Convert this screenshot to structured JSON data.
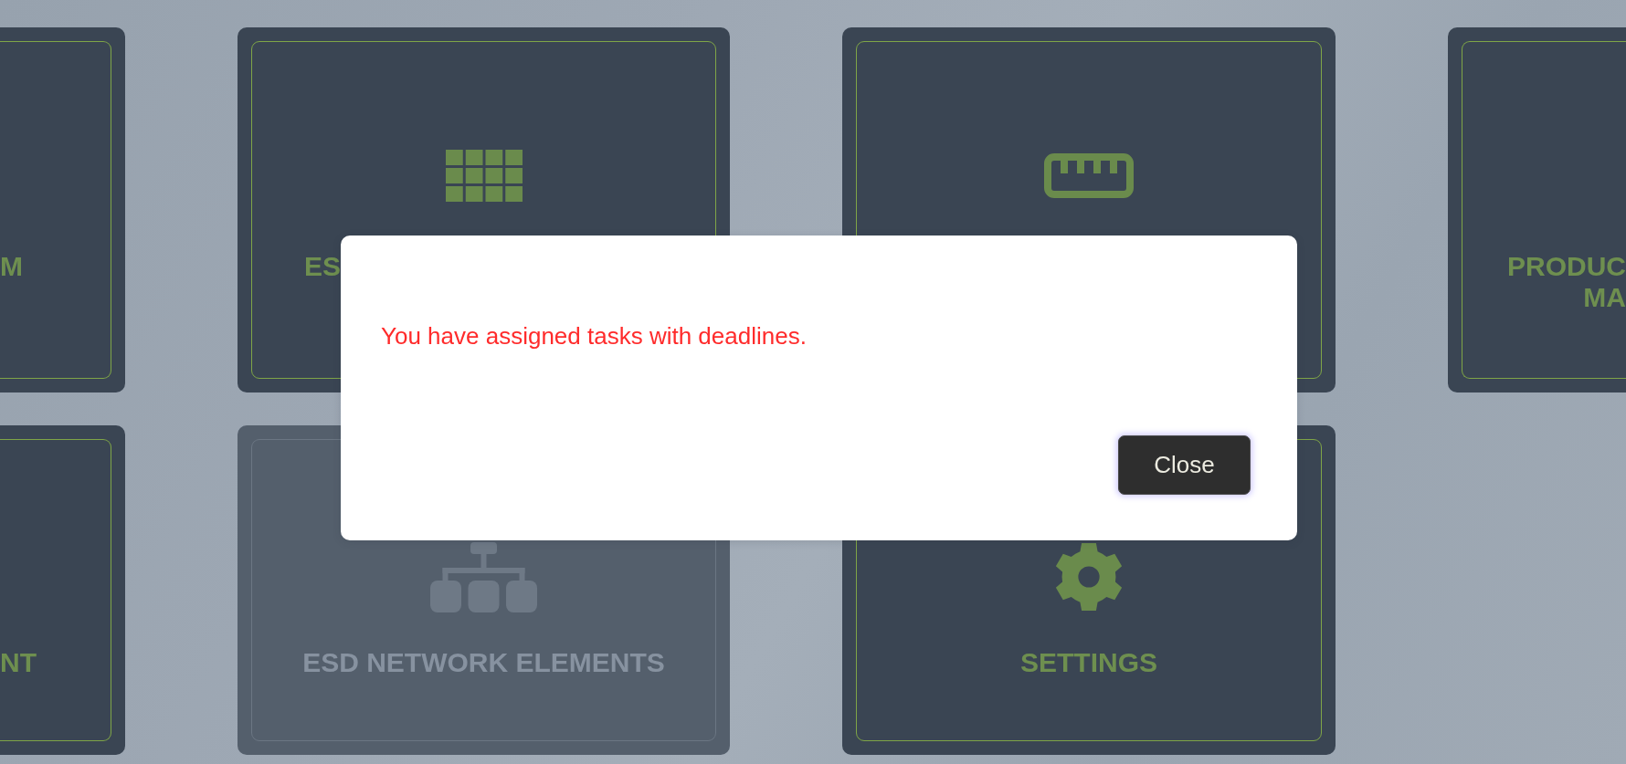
{
  "tiles": [
    {
      "title_lines": [
        "M"
      ],
      "disabled": false
    },
    {
      "title_lines": [
        "ES"
      ],
      "disabled": false
    },
    {
      "disabled": false
    },
    {
      "title_lines": [
        "PRODUC",
        "MA"
      ],
      "disabled": false
    },
    {
      "title_lines": [
        "NT"
      ],
      "disabled": false
    },
    {
      "title_lines": [
        "ESD NETWORK ELEMENTS"
      ],
      "disabled": true
    },
    {
      "title_lines": [
        "SETTINGS"
      ],
      "disabled": false
    }
  ],
  "dialog": {
    "message": "You have assigned tasks with deadlines.",
    "buttons": [
      {
        "label": "Close",
        "focused": true
      }
    ]
  }
}
